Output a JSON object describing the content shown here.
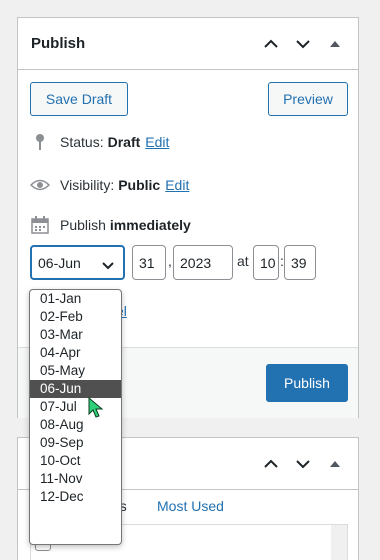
{
  "publish_box": {
    "title": "Publish",
    "save_draft": "Save Draft",
    "preview": "Preview",
    "status_label": "Status:",
    "status_value": "Draft",
    "status_edit": "Edit",
    "visibility_label": "Visibility:",
    "visibility_value": "Public",
    "visibility_edit": "Edit",
    "publish_label": "Publish",
    "publish_value": "immediately",
    "month_selected": "06-Jun",
    "day": "31",
    "year": "2023",
    "at": "at",
    "hour": "10",
    "minute": "39",
    "cancel_partial": "el",
    "trash_partial": "h",
    "publish_button": "Publish"
  },
  "month_options": [
    "01-Jan",
    "02-Feb",
    "03-Mar",
    "04-Apr",
    "05-May",
    "06-Jun",
    "07-Jul",
    "08-Aug",
    "09-Sep",
    "10-Oct",
    "11-Nov",
    "12-Dec"
  ],
  "selected_month_index": 5,
  "categories_box": {
    "tab_all_partial": "es",
    "tab_most_used": "Most Used"
  },
  "colors": {
    "accent": "#2271b1",
    "danger": "#b32d2e",
    "selected_option": "#505050",
    "cursor": "#2fd07a"
  }
}
